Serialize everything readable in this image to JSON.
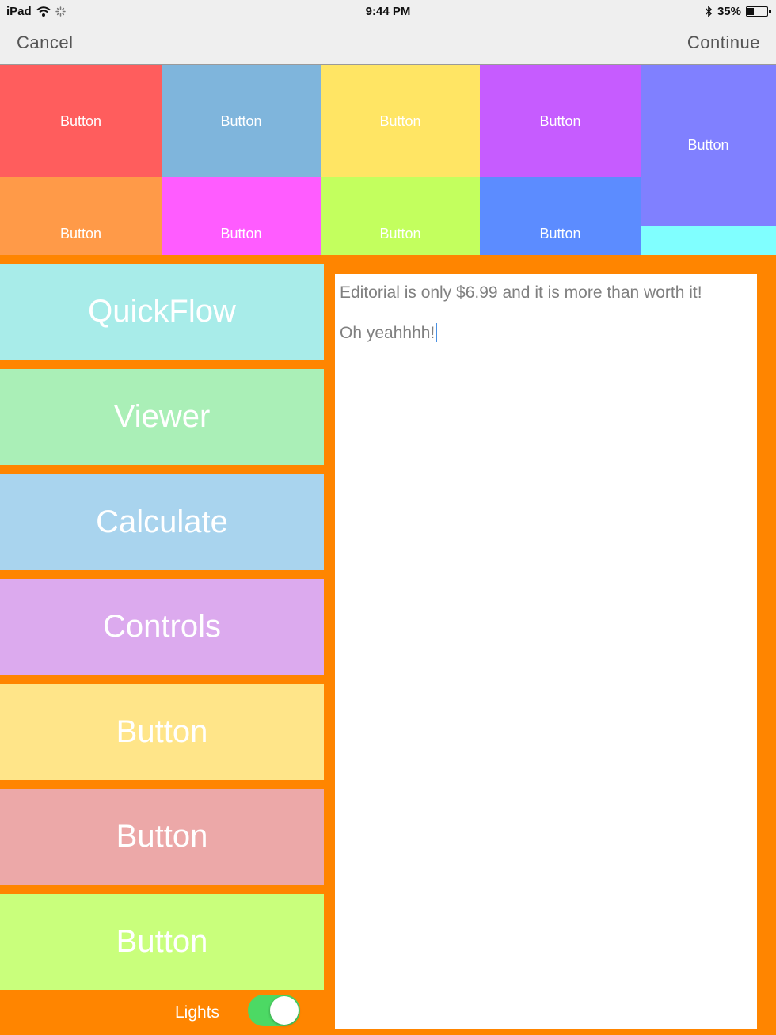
{
  "status_bar": {
    "device": "iPad",
    "time": "9:44 PM",
    "battery_text": "35%",
    "battery_level": 0.35,
    "icons": [
      "wifi-icon",
      "activity-spinner-icon",
      "bluetooth-icon",
      "battery-icon"
    ]
  },
  "nav": {
    "cancel_label": "Cancel",
    "continue_label": "Continue"
  },
  "grid": {
    "tiles": [
      {
        "label": "Button",
        "color": "#ff5d5d"
      },
      {
        "label": "Button",
        "color": "#7fb5dc"
      },
      {
        "label": "Button",
        "color": "#ffe564"
      },
      {
        "label": "Button",
        "color": "#c65cff"
      },
      {
        "label": "Button",
        "color": "#8080ff"
      },
      {
        "label": "Button",
        "color": "#ff9a48"
      },
      {
        "label": "Button",
        "color": "#ff5cff"
      },
      {
        "label": "Button",
        "color": "#c3ff5e"
      },
      {
        "label": "Button",
        "color": "#5c8cff"
      },
      {
        "label": "",
        "color": "#80ffff"
      }
    ]
  },
  "side_buttons": [
    {
      "label": "QuickFlow",
      "color": "#a8ece9"
    },
    {
      "label": "Viewer",
      "color": "#aaefb7"
    },
    {
      "label": "Calculate",
      "color": "#a9d4ee"
    },
    {
      "label": "Controls",
      "color": "#dcaaee"
    },
    {
      "label": "Button",
      "color": "#ffe589"
    },
    {
      "label": "Button",
      "color": "#eca8a8"
    },
    {
      "label": "Button",
      "color": "#c9ff7c"
    }
  ],
  "lights": {
    "label": "Lights",
    "on": true,
    "color": "#4cd964"
  },
  "editor": {
    "lines": [
      "Editorial is only $6.99 and it is more than worth it!",
      "Oh yeahhhh!"
    ]
  },
  "colors": {
    "background": "#ff8500",
    "bar": "#efefef"
  }
}
